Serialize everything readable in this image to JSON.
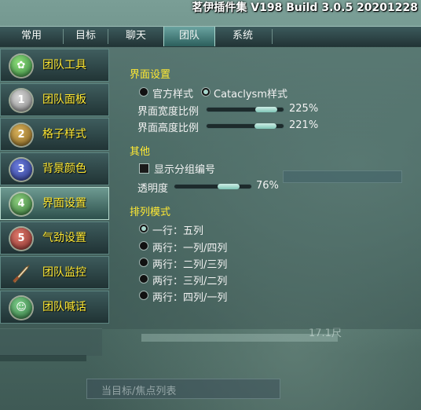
{
  "window": {
    "title": "茗伊插件集 V198 Build 3.0.5 20201228"
  },
  "tabs": [
    {
      "label": "常用",
      "active": false
    },
    {
      "label": "目标",
      "active": false
    },
    {
      "label": "聊天",
      "active": false
    },
    {
      "label": "团队",
      "active": true
    },
    {
      "label": "系统",
      "active": false
    }
  ],
  "sidebar": {
    "items": [
      {
        "label": "团队工具",
        "icon": "team-tools-icon",
        "active": false
      },
      {
        "label": "团队面板",
        "icon": "number-1-badge-icon",
        "badge": "1",
        "active": false
      },
      {
        "label": "格子样式",
        "icon": "number-2-badge-icon",
        "badge": "2",
        "active": false
      },
      {
        "label": "背景颜色",
        "icon": "number-3-badge-icon",
        "badge": "3",
        "active": false
      },
      {
        "label": "界面设置",
        "icon": "number-4-badge-icon",
        "badge": "4",
        "active": true
      },
      {
        "label": "气劲设置",
        "icon": "number-5-badge-icon",
        "badge": "5",
        "active": false
      },
      {
        "label": "团队监控",
        "icon": "sword-icon",
        "active": false
      },
      {
        "label": "团队喊话",
        "icon": "shout-icon",
        "active": false
      }
    ]
  },
  "ui_settings": {
    "heading": "界面设置",
    "style_options": [
      {
        "label": "官方样式",
        "selected": false
      },
      {
        "label": "Cataclysm样式",
        "selected": true
      }
    ],
    "width_scale": {
      "label": "界面宽度比例",
      "value": "225%",
      "fill": 0.62
    },
    "height_scale": {
      "label": "界面高度比例",
      "value": "221%",
      "fill": 0.61
    }
  },
  "other": {
    "heading": "其他",
    "show_group_number": {
      "label": "显示分组编号",
      "checked": false
    },
    "opacity": {
      "label": "透明度",
      "value": "76%",
      "fill": 0.76
    }
  },
  "layout_mode": {
    "heading": "排列模式",
    "options": [
      {
        "label": "一行：五列",
        "selected": true
      },
      {
        "label": "两行：一列/四列",
        "selected": false
      },
      {
        "label": "两行：二列/三列",
        "selected": false
      },
      {
        "label": "两行：三列/二列",
        "selected": false
      },
      {
        "label": "两行：四列/一列",
        "selected": false
      }
    ]
  },
  "background": {
    "distance_text": "17.1尺",
    "target_list_label": "当目标/焦点列表"
  },
  "colors": {
    "accent_yellow": "#ffe933",
    "slider_fill": "#a8d6cc"
  }
}
